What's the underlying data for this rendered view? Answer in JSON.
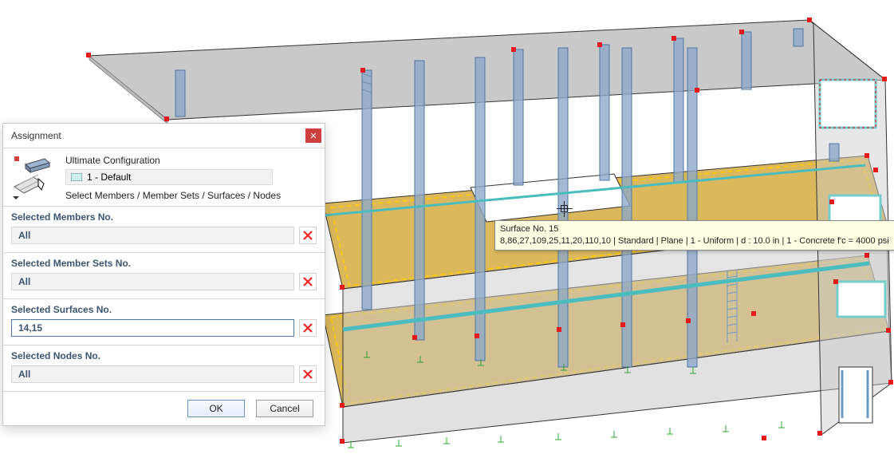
{
  "dialog": {
    "title": "Assignment",
    "config_label": "Ultimate Configuration",
    "default_label": "1 - Default",
    "sub_label": "Select Members / Member Sets / Surfaces / Nodes",
    "sections": {
      "members": {
        "label": "Selected Members No.",
        "value": "All"
      },
      "membersets": {
        "label": "Selected Member Sets No.",
        "value": "All"
      },
      "surfaces": {
        "label": "Selected Surfaces No.",
        "value": "14,15"
      },
      "nodes": {
        "label": "Selected Nodes No.",
        "value": "All"
      }
    },
    "ok": "OK",
    "cancel": "Cancel"
  },
  "tooltip": {
    "line1": "Surface No. 15",
    "line2": "8,86,27,109,25,11,20,110,10 | Standard | Plane | 1 - Uniform | d : 10.0 in | 1 - Concrete f'c = 4000 psi"
  }
}
